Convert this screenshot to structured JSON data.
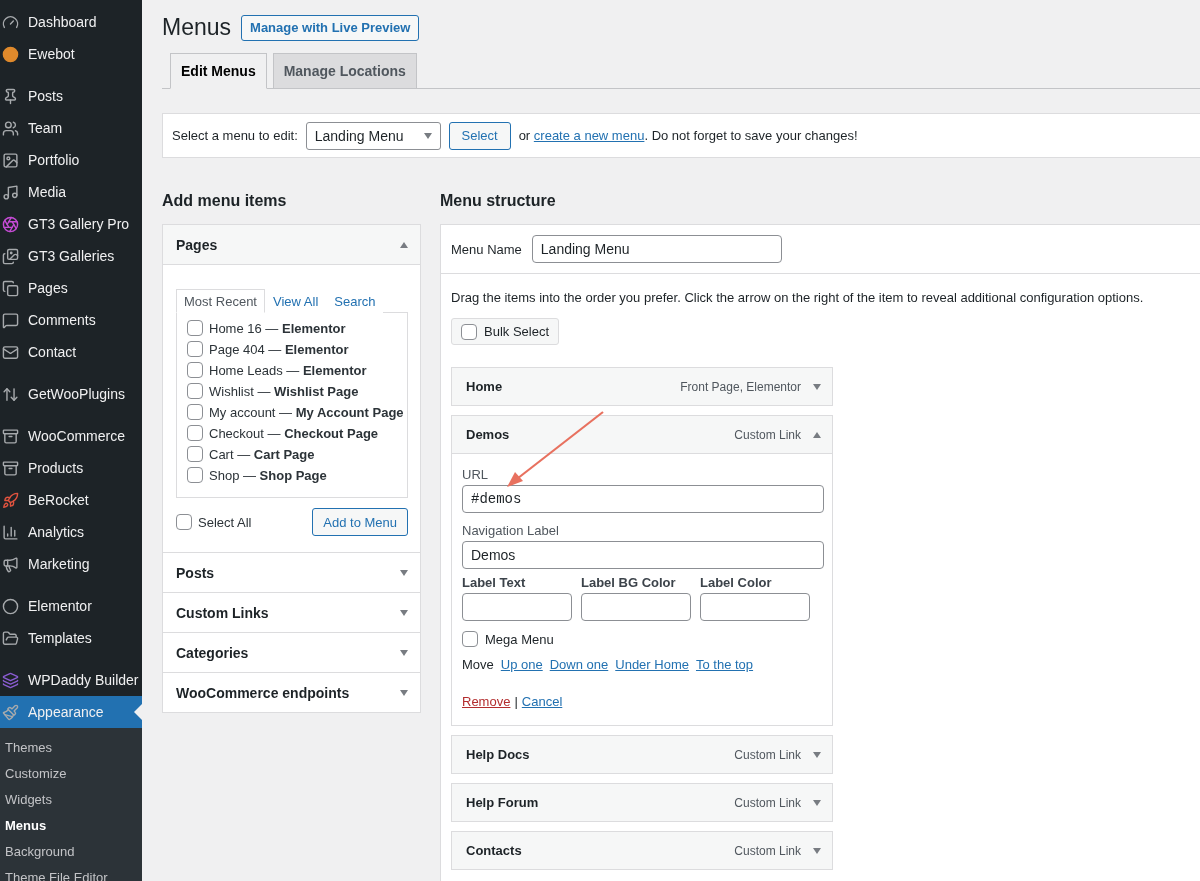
{
  "sidebar": {
    "groups": [
      [
        {
          "label": "Dashboard",
          "selected": false
        },
        {
          "label": "Ewebot",
          "selected": false
        }
      ],
      [
        {
          "label": "Posts",
          "selected": false
        },
        {
          "label": "Team",
          "selected": false
        },
        {
          "label": "Portfolio",
          "selected": false
        },
        {
          "label": "Media",
          "selected": false
        },
        {
          "label": "GT3 Gallery Pro",
          "selected": false
        },
        {
          "label": "GT3 Galleries",
          "selected": false
        },
        {
          "label": "Pages",
          "selected": false
        },
        {
          "label": "Comments",
          "selected": false
        },
        {
          "label": "Contact",
          "selected": false
        }
      ],
      [
        {
          "label": "GetWooPlugins",
          "selected": false
        }
      ],
      [
        {
          "label": "WooCommerce",
          "selected": false
        },
        {
          "label": "Products",
          "selected": false
        },
        {
          "label": "BeRocket",
          "selected": false
        },
        {
          "label": "Analytics",
          "selected": false
        },
        {
          "label": "Marketing",
          "selected": false
        }
      ],
      [
        {
          "label": "Elementor",
          "selected": false
        },
        {
          "label": "Templates",
          "selected": false
        }
      ],
      [
        {
          "label": "WPDaddy Builder",
          "selected": false
        },
        {
          "label": "Appearance",
          "selected": true,
          "children": [
            {
              "label": "Themes",
              "selected": false
            },
            {
              "label": "Customize",
              "selected": false
            },
            {
              "label": "Widgets",
              "selected": false
            },
            {
              "label": "Menus",
              "selected": true
            },
            {
              "label": "Background",
              "selected": false
            },
            {
              "label": "Theme File Editor",
              "selected": false
            }
          ]
        }
      ]
    ]
  },
  "page": {
    "title": "Menus",
    "action": "Manage with Live Preview",
    "tabs": [
      {
        "label": "Edit Menus",
        "selected": true
      },
      {
        "label": "Manage Locations",
        "selected": false
      }
    ]
  },
  "select_bar": {
    "label": "Select a menu to edit:",
    "value": "Landing Menu",
    "button": "Select",
    "text_before_link": "or",
    "link": "create a new menu",
    "text_after_link": ". Do not forget to save your changes!"
  },
  "add_items": {
    "heading": "Add menu items",
    "sections": [
      {
        "title": "Pages",
        "expanded": true,
        "tabs": [
          {
            "label": "Most Recent",
            "selected": true
          },
          {
            "label": "View All",
            "selected": false
          },
          {
            "label": "Search",
            "selected": false
          }
        ],
        "items": [
          {
            "label": "Home 16 — **Elementor**",
            "checked": false
          },
          {
            "label": "Page 404 — **Elementor**",
            "checked": false
          },
          {
            "label": "Home Leads — **Elementor**",
            "checked": false
          },
          {
            "label": "Wishlist — **Wishlist Page**",
            "checked": false
          },
          {
            "label": "My account — **My Account Page**",
            "checked": false
          },
          {
            "label": "Checkout — **Checkout Page**",
            "checked": false
          },
          {
            "label": "Cart — **Cart Page**",
            "checked": false
          },
          {
            "label": "Shop — **Shop Page**",
            "checked": false
          }
        ],
        "select_all": {
          "label": "Select All",
          "checked": false
        },
        "button": "Add to Menu"
      },
      {
        "title": "Posts",
        "expanded": false
      },
      {
        "title": "Custom Links",
        "expanded": false
      },
      {
        "title": "Categories",
        "expanded": false
      },
      {
        "title": "WooCommerce endpoints",
        "expanded": false
      }
    ]
  },
  "menu_structure": {
    "heading": "Menu structure",
    "name_label": "Menu Name",
    "name_value": "Landing Menu",
    "instructions": "Drag the items into the order you prefer. Click the arrow on the right of the item to reveal additional configuration options.",
    "bulk_select": {
      "label": "Bulk Select",
      "checked": false
    },
    "items": [
      {
        "title": "Home",
        "type": "Front Page, Elementor",
        "expanded": false
      },
      {
        "title": "Demos",
        "type": "Custom Link",
        "expanded": true,
        "settings": {
          "url_label": "URL",
          "url": "#demos",
          "nav_label_label": "Navigation Label",
          "nav_label": "Demos",
          "extra_fields": [
            {
              "label": "Label Text"
            },
            {
              "label": "Label BG Color"
            },
            {
              "label": "Label Color"
            }
          ],
          "mega_menu": {
            "label": "Mega Menu",
            "checked": false
          },
          "move_label": "Move",
          "move_links": [
            "Up one",
            "Down one",
            "Under Home",
            "To the top"
          ],
          "remove": "Remove",
          "separator": "|",
          "cancel": "Cancel"
        }
      },
      {
        "title": "Help Docs",
        "type": "Custom Link",
        "expanded": false
      },
      {
        "title": "Help Forum",
        "type": "Custom Link",
        "expanded": false
      },
      {
        "title": "Contacts",
        "type": "Custom Link",
        "expanded": false
      }
    ]
  }
}
